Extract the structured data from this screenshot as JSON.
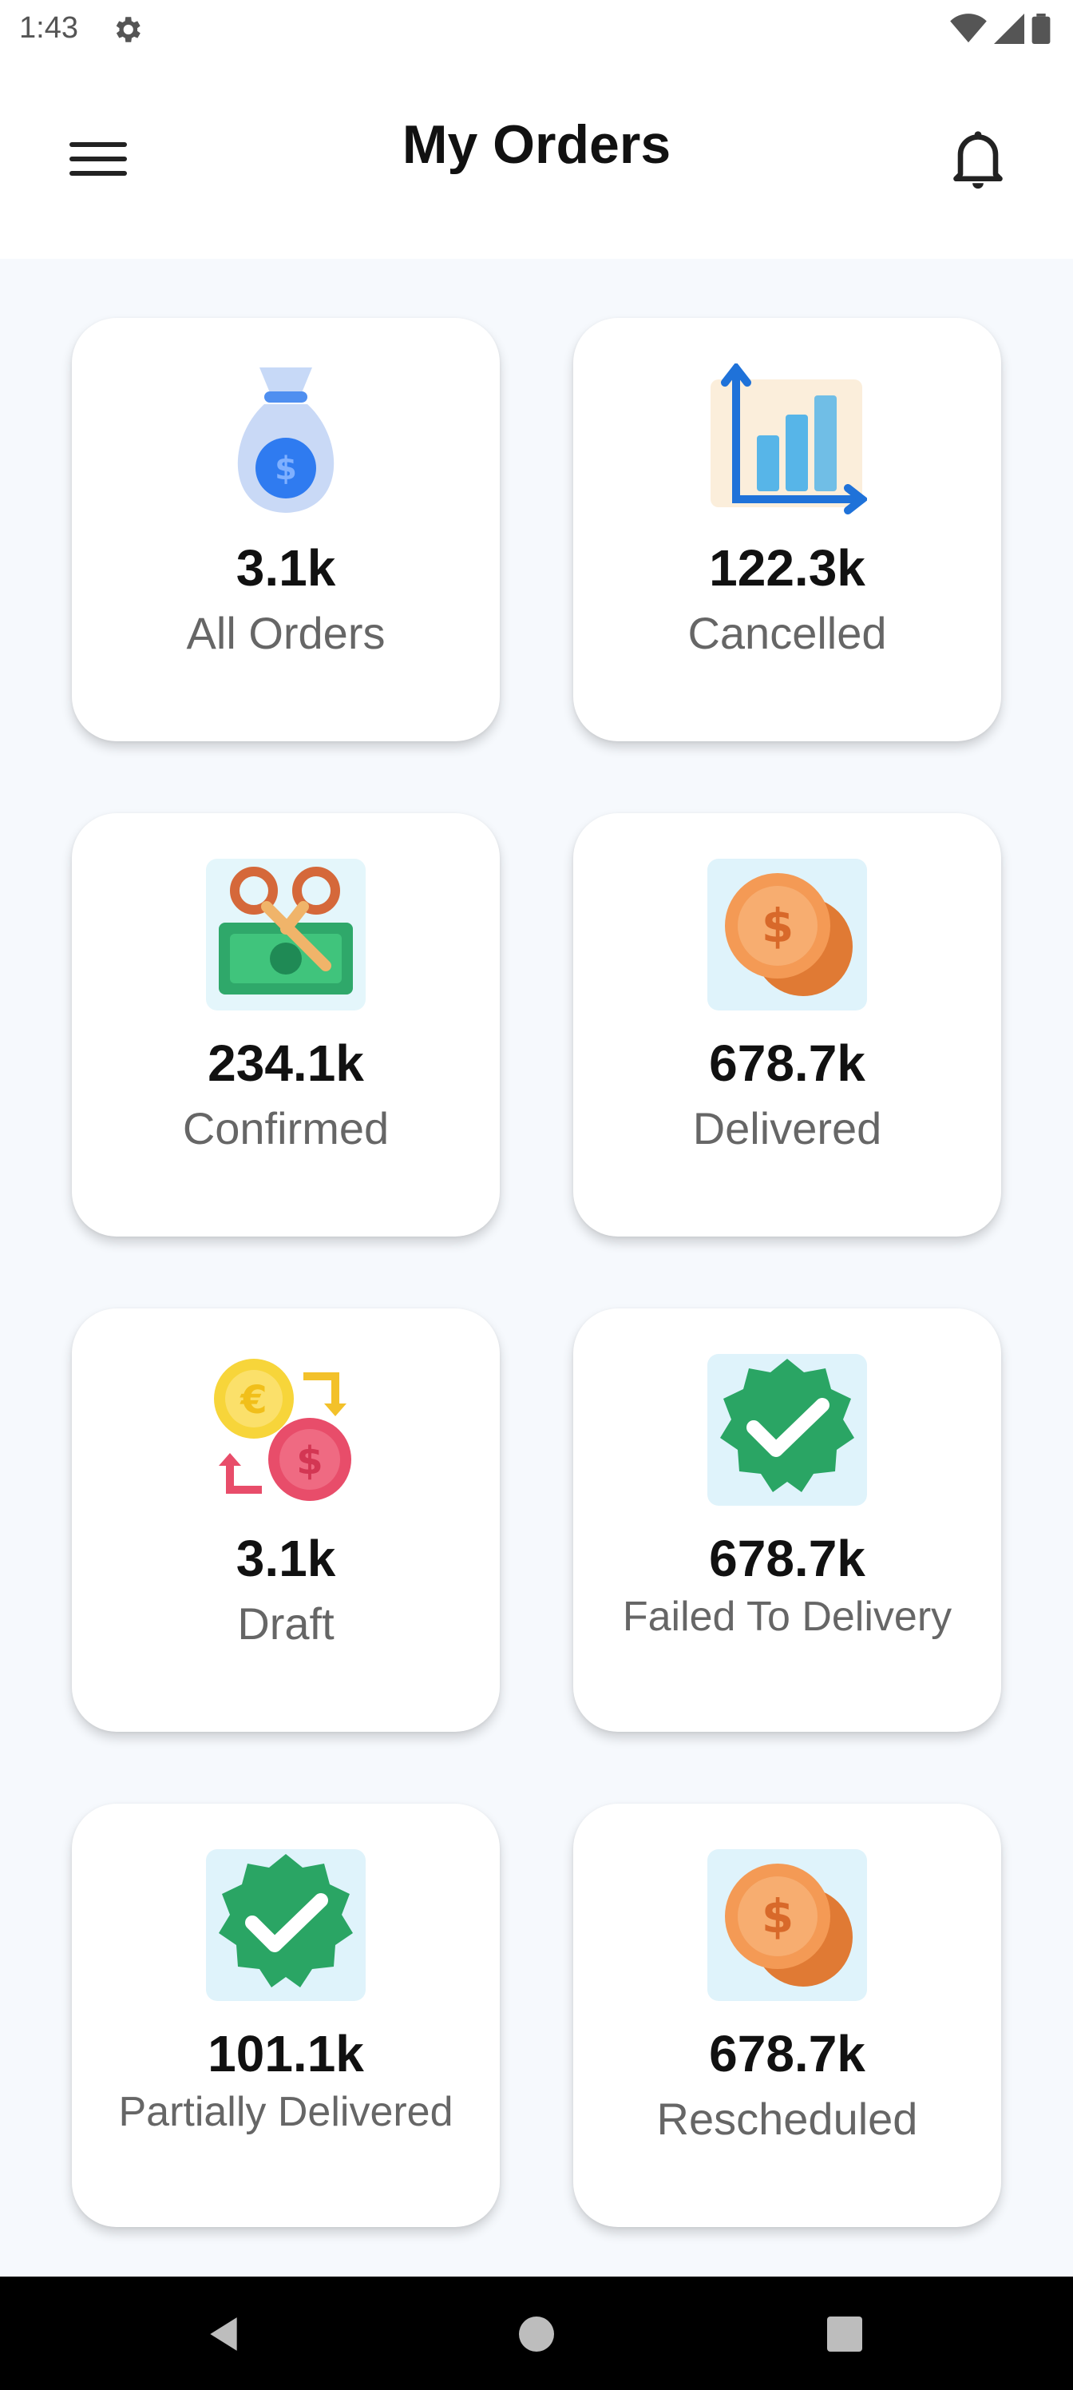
{
  "status_bar": {
    "time": "1:43"
  },
  "header": {
    "title": "My Orders"
  },
  "cards": [
    {
      "count": "3.1k",
      "label": "All Orders",
      "icon": "money-bag-icon"
    },
    {
      "count": "122.3k",
      "label": "Cancelled",
      "icon": "bar-chart-icon"
    },
    {
      "count": "234.1k",
      "label": "Confirmed",
      "icon": "cash-scissors-icon"
    },
    {
      "count": "678.7k",
      "label": "Delivered",
      "icon": "coins-icon"
    },
    {
      "count": "3.1k",
      "label": "Draft",
      "icon": "currency-exchange-icon"
    },
    {
      "count": "678.7k",
      "label": "Failed To Delivery",
      "icon": "verified-badge-icon"
    },
    {
      "count": "101.1k",
      "label": "Partially Delivered",
      "icon": "verified-badge-icon"
    },
    {
      "count": "678.7k",
      "label": "Rescheduled",
      "icon": "coins-icon"
    }
  ],
  "colors": {
    "background": "#f6f9fd",
    "card": "#ffffff",
    "text_primary": "#111111",
    "text_secondary": "#666666",
    "nav_bar": "#000000"
  }
}
